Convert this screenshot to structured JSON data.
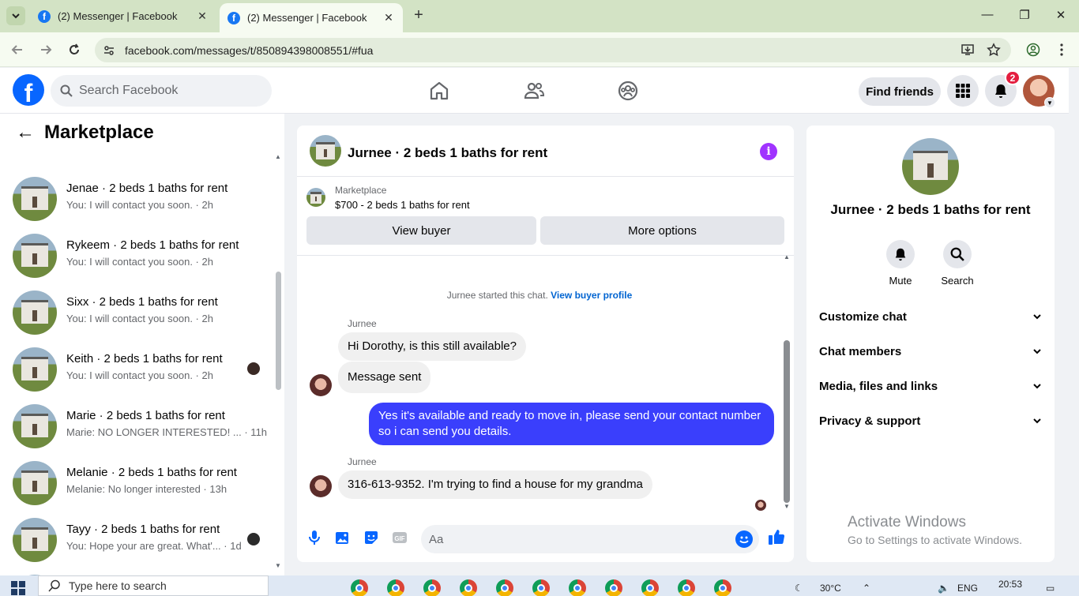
{
  "browser": {
    "tabs": [
      {
        "title": "(2) Messenger | Facebook",
        "active": false
      },
      {
        "title": "(2) Messenger | Facebook",
        "active": true
      }
    ],
    "url": "facebook.com/messages/t/850894398008551/#fua"
  },
  "fb_header": {
    "search_placeholder": "Search Facebook",
    "find_friends_label": "Find friends",
    "notification_count": "2"
  },
  "sidebar": {
    "title": "Marketplace",
    "conversations": [
      {
        "name": "Jenae · 2 beds 1 baths for rent",
        "snippet": "You: I will contact you soon. · 2h",
        "has_avatar": false
      },
      {
        "name": "Rykeem · 2 beds 1 baths for rent",
        "snippet": "You: I will contact you soon. · 2h",
        "has_avatar": false
      },
      {
        "name": "Sixx · 2 beds 1 baths for rent",
        "snippet": "You: I will contact you soon. · 2h",
        "has_avatar": false
      },
      {
        "name": "Keith · 2 beds 1 baths for rent",
        "snippet": "You: I will contact you soon. · 2h",
        "has_avatar": true
      },
      {
        "name": "Marie · 2 beds 1 baths for rent",
        "snippet": "Marie: NO LONGER INTERESTED! ... · 11h",
        "has_avatar": false
      },
      {
        "name": "Melanie · 2 beds 1 baths for rent",
        "snippet": "Melanie: No longer interested · 13h",
        "has_avatar": false
      },
      {
        "name": "Tayy · 2 beds 1 baths for rent",
        "snippet": "You: Hope your are great. What'... · 1d",
        "has_avatar": true
      }
    ]
  },
  "chat": {
    "title": "Jurnee · 2 beds 1 baths for rent",
    "marketplace_label": "Marketplace",
    "listing": "$700 - 2 beds 1 baths for rent",
    "view_buyer_label": "View buyer",
    "more_options_label": "More options",
    "system_text": "Jurnee started this chat.",
    "system_link": "View buyer profile",
    "sender_name": "Jurnee",
    "messages": [
      {
        "from": "Jurnee",
        "text": "Hi Dorothy, is this still available?"
      },
      {
        "from": "Jurnee",
        "text": "Message sent"
      },
      {
        "from": "me",
        "text": "Yes it's available and ready to move in, please send your contact number so i can send you details."
      },
      {
        "from": "Jurnee",
        "text": "316-613-9352. I'm trying to find a house for my grandma"
      }
    ],
    "composer_placeholder": "Aa"
  },
  "details": {
    "name": "Jurnee · 2 beds 1 baths for rent",
    "mute_label": "Mute",
    "search_label": "Search",
    "sections": [
      "Customize chat",
      "Chat members",
      "Media, files and links",
      "Privacy & support"
    ]
  },
  "watermark": {
    "line1": "Activate Windows",
    "line2": "Go to Settings to activate Windows."
  },
  "taskbar": {
    "search_placeholder": "Type here to search",
    "temperature": "30°C",
    "language": "ENG",
    "time": "20:53"
  },
  "colors": {
    "accent": "#0866ff",
    "outgoing_bubble": "#3a3ffc",
    "info_button": "#a033ff",
    "badge": "#e41e3f"
  }
}
